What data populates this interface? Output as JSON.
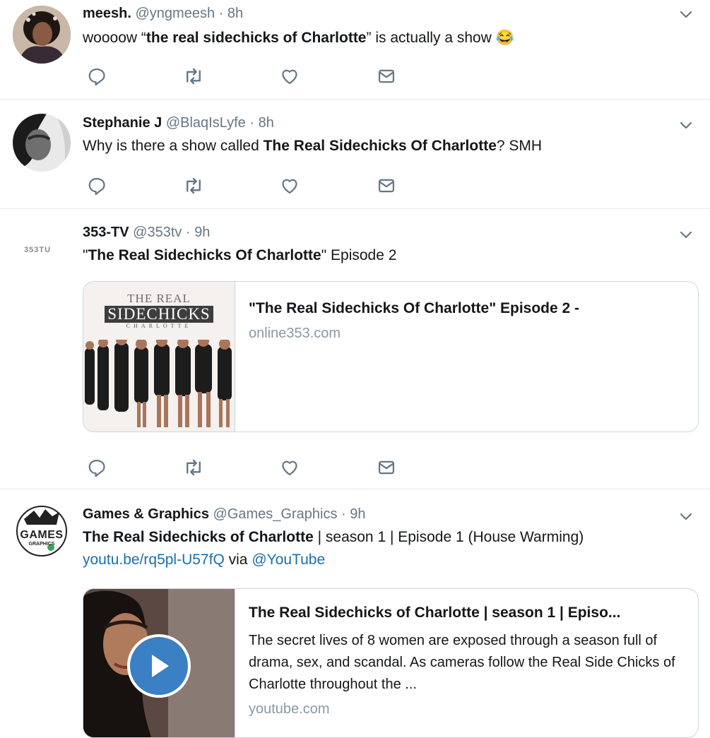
{
  "tweets": [
    {
      "name": "meesh.",
      "handle": "@yngmeesh",
      "dot": "·",
      "time": "8h",
      "text_pre": "woooow “",
      "text_bold": "the real sidechicks of Charlotte",
      "text_post": "” is actually a show",
      "emoji": "😂"
    },
    {
      "name": "Stephanie J",
      "handle": "@BlaqIsLyfe",
      "dot": "·",
      "time": "8h",
      "text_pre": "Why is there a show called ",
      "text_bold": "The Real Sidechicks Of Charlotte",
      "text_post": "? SMH"
    },
    {
      "name": "353-TV",
      "handle": "@353tv",
      "dot": "·",
      "time": "9h",
      "avatar_text": "353TU",
      "text_pre": "\"",
      "text_bold": "The Real Sidechicks Of Charlotte",
      "text_post": "\" Episode 2",
      "card": {
        "title": "\"The Real Sidechicks Of Charlotte\" Episode 2 -",
        "domain": "online353.com",
        "poster_line1": "THE REAL",
        "poster_line2": "SIDECHICKS",
        "poster_line3": "CHARLOTTE"
      }
    },
    {
      "name": "Games & Graphics",
      "handle": "@Games_Graphics",
      "dot": "·",
      "time": "9h",
      "avatar_text_1": "GAMES",
      "avatar_text_2": "GRAPHICS",
      "text_bold": "The Real Sidechicks of Charlotte",
      "text_post": " | season 1 | Episode 1 (House Warming)",
      "link": "youtu.be/rq5pl-U57fQ",
      "via": " via ",
      "mention": "@YouTube",
      "card": {
        "title": "The Real Sidechicks of Charlotte | season 1 | Episo...",
        "desc": "The secret lives of 8 women are exposed through a season full of drama, sex, and scandal. As cameras follow the Real Side Chicks of Charlotte throughout the ...",
        "domain": "youtube.com"
      }
    }
  ],
  "icons": {
    "reply": "reply-icon",
    "retweet": "retweet-icon",
    "like": "heart-icon",
    "dm": "envelope-icon",
    "caret": "chevron-down-icon",
    "play": "play-icon"
  },
  "colors": {
    "text": "#14171a",
    "secondary": "#657786",
    "link": "#1b6faa",
    "border": "#e6ecf0",
    "play_button": "#3b7fc4"
  }
}
